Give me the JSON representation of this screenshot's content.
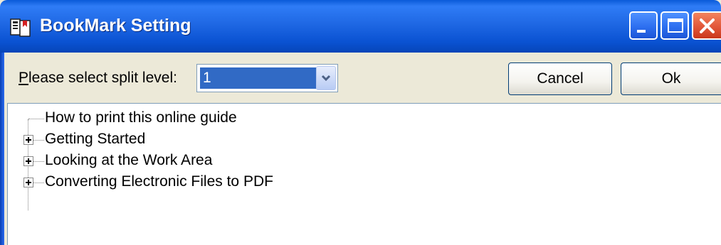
{
  "window": {
    "title": "BookMark Setting",
    "icon": "bookmark-app-icon",
    "controls": [
      "minimize-icon",
      "maximize-icon",
      "close-icon"
    ]
  },
  "toolbar": {
    "split_label_accel": "P",
    "split_label_rest": "lease select split level:",
    "split_level_value": "1",
    "cancel_label": "Cancel",
    "ok_label": "Ok"
  },
  "tree": {
    "items": [
      {
        "label": "How to print this online guide",
        "expandable": false
      },
      {
        "label": "Getting Started",
        "expandable": true
      },
      {
        "label": "Looking at the Work Area",
        "expandable": true
      },
      {
        "label": "Converting Electronic Files to PDF",
        "expandable": true
      }
    ]
  },
  "colors": {
    "titlebar": "#0a52d2",
    "selection": "#316ac5",
    "close": "#e2573a",
    "dialog_bg": "#ece9d8"
  }
}
